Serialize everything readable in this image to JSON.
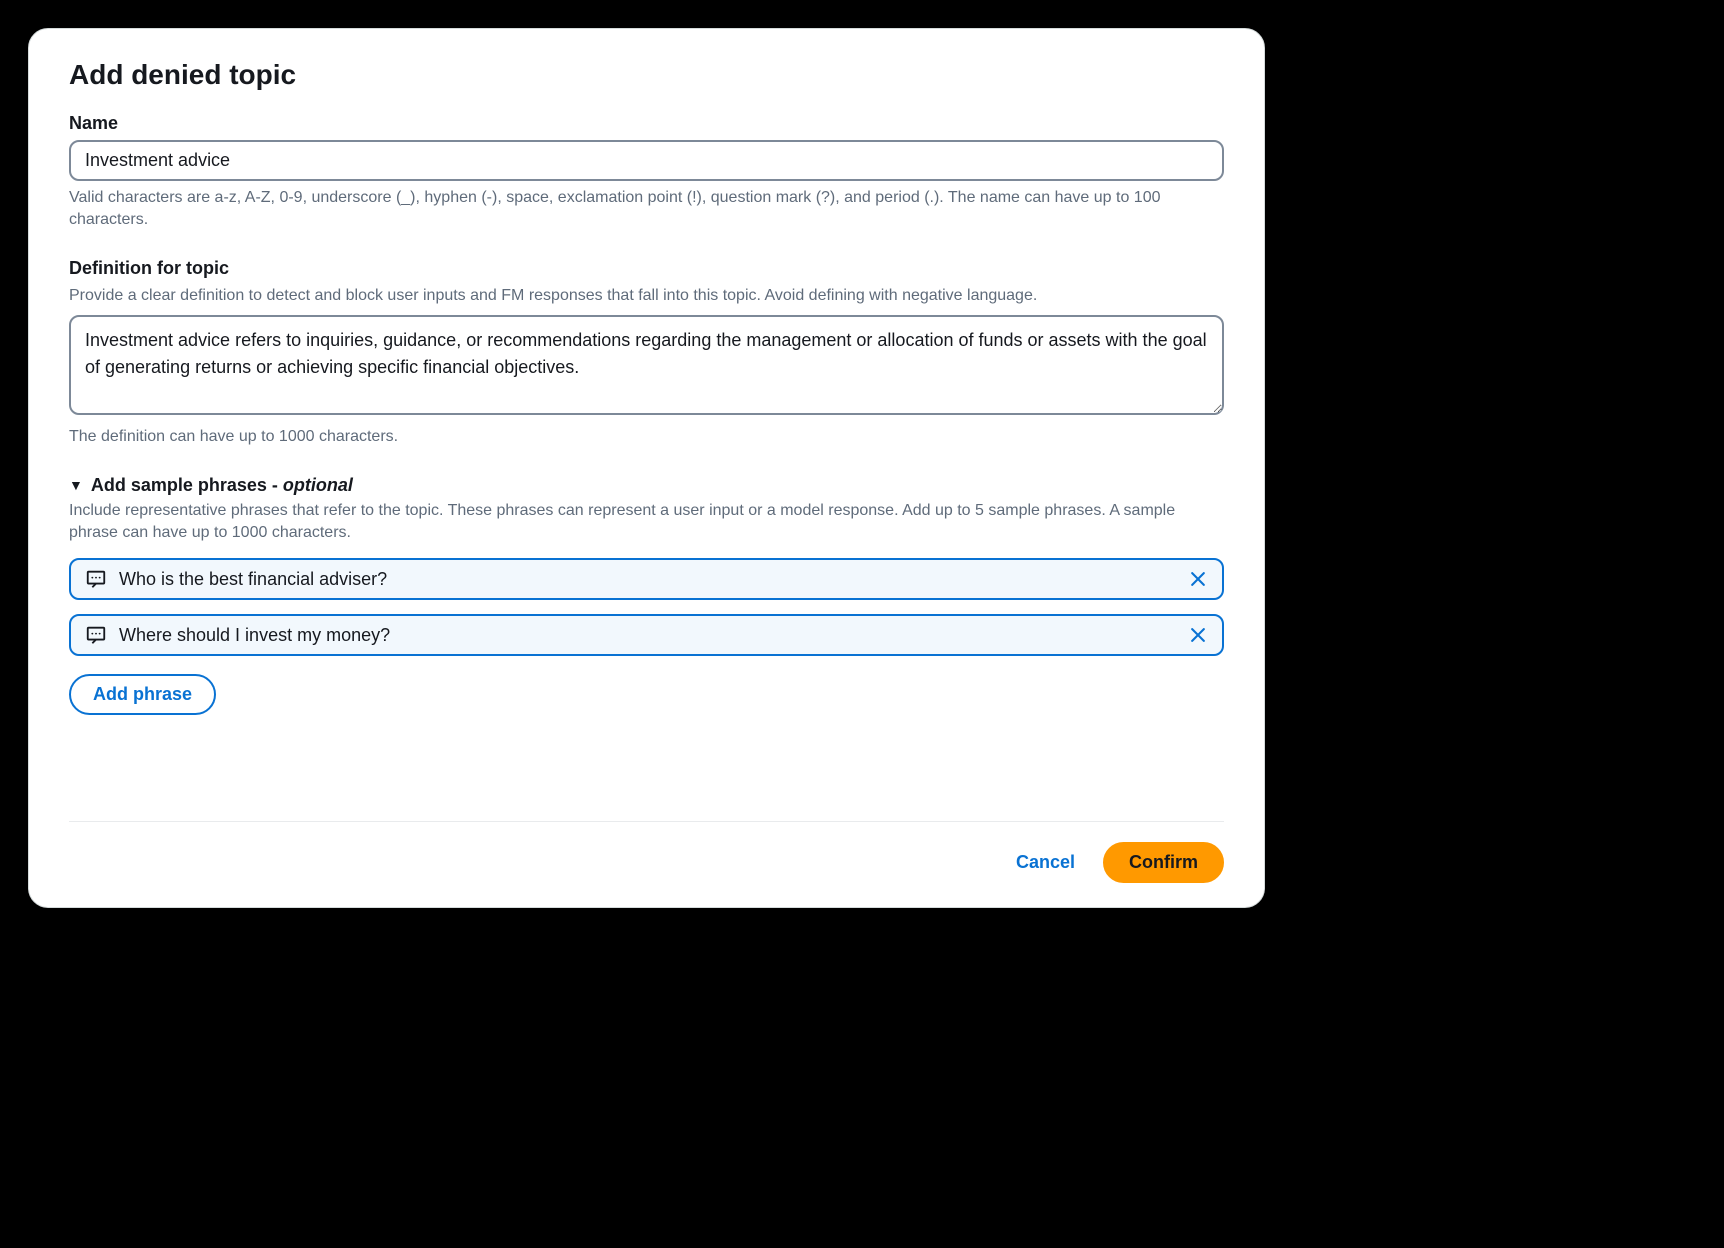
{
  "modal": {
    "title": "Add denied topic",
    "name_field": {
      "label": "Name",
      "value": "Investment advice",
      "hint": "Valid characters are a-z, A-Z, 0-9, underscore (_), hyphen (-), space, exclamation point (!), question mark (?), and period (.). The name can have up to 100 characters."
    },
    "definition_field": {
      "label": "Definition for topic",
      "description": "Provide a clear definition to detect and block user inputs and FM responses that fall into this topic. Avoid defining with negative language.",
      "value": "Investment advice refers to inquiries, guidance, or recommendations regarding the management or allocation of funds or assets with the goal of generating returns or achieving specific financial objectives.",
      "hint": "The definition can have up to 1000 characters."
    },
    "sample_phrases": {
      "title": "Add sample phrases - ",
      "optional_label": "optional",
      "description": "Include representative phrases that refer to the topic. These phrases can represent a user input or a model response. Add up to 5 sample phrases. A sample phrase can have up to 1000 characters.",
      "phrases": [
        "Who is the best financial adviser?",
        "Where should I invest my money?"
      ],
      "add_button_label": "Add phrase"
    },
    "footer": {
      "cancel_label": "Cancel",
      "confirm_label": "Confirm"
    }
  }
}
